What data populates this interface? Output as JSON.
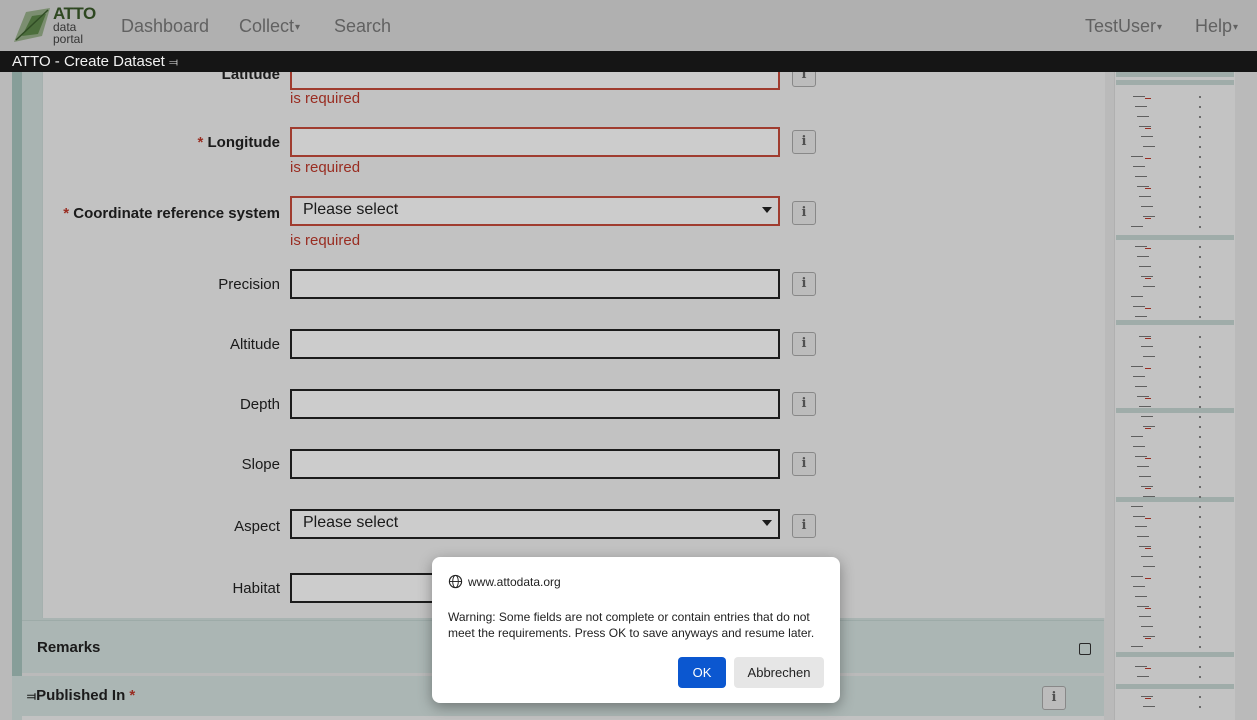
{
  "navbar": {
    "logo_title": "ATTO",
    "logo_line2": "data",
    "logo_line3": "portal",
    "dashboard": "Dashboard",
    "collect": "Collect",
    "search": "Search",
    "user": "TestUser",
    "help": "Help"
  },
  "subbar": {
    "title": "ATTO - Create Dataset"
  },
  "form": {
    "latitude_label": "Latitude",
    "longitude_label": "Longitude",
    "crs_label": "Coordinate reference system",
    "crs_value": "Please select",
    "precision_label": "Precision",
    "altitude_label": "Altitude",
    "depth_label": "Depth",
    "slope_label": "Slope",
    "aspect_label": "Aspect",
    "aspect_value": "Please select",
    "habitat_label": "Habitat",
    "required_msg": "is required",
    "required_mark": "*",
    "info_icon": "i"
  },
  "sections": {
    "remarks": "Remarks",
    "published_in": "Published In"
  },
  "dialog": {
    "host": "www.attodata.org",
    "message": "Warning: Some fields are not complete or contain entries that do not meet the requirements. Press OK to save anyways and resume later.",
    "ok": "OK",
    "cancel": "Abbrechen"
  },
  "colors": {
    "accent_blue": "#0b57d0",
    "error_red": "#c0392b",
    "panel_teal": "#d6e4e1"
  }
}
